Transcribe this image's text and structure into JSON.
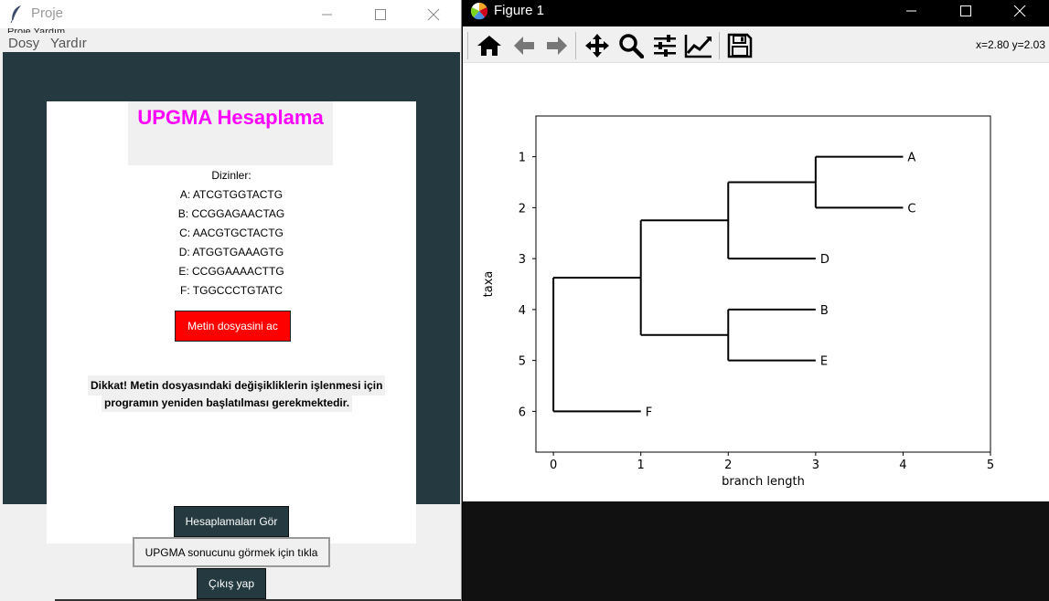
{
  "tk_window": {
    "title": "Proje",
    "clipped_text": "Proje Yardım",
    "menu": [
      "Dosy",
      "Yardır"
    ],
    "heading": "UPGMA Hesaplama",
    "sequences_title": "Dizinler:",
    "sequences": [
      "A: ATCGTGGTACTG",
      "B: CCGGAGAACTAG",
      "C: AACGTGCTACTG",
      "D: ATGGTGAAAGTG",
      "E: CCGGAAAACTTG",
      "F: TGGCCCTGTATC"
    ],
    "open_file_button": "Metin dosyasini ac",
    "warning_line1": "Dikkat! Metin dosyasındaki değişikliklerin işlenmesi için",
    "warning_line2": "programın yeniden başlatılması gerekmektedir.",
    "calc_button": "Hesaplamaları Gör",
    "upgma_button": "UPGMA sonucunu görmek için tıkla",
    "exit_button": "Çıkış yap",
    "colors": {
      "heading": "#ff00ff",
      "dark_bg": "#253a40",
      "open_button": "#ff0000"
    }
  },
  "figure_window": {
    "title": "Figure 1",
    "toolbar": [
      "home-icon",
      "back-icon",
      "forward-icon",
      "pan-icon",
      "zoom-icon",
      "configure-subplots-icon",
      "edit-axis-icon",
      "save-icon"
    ],
    "coord_readout": "x=2.80 y=2.03"
  },
  "chart_data": {
    "type": "dendrogram",
    "xlabel": "branch length",
    "ylabel": "taxa",
    "xlim": [
      -0.2,
      5
    ],
    "ylim": [
      6.8,
      0.2
    ],
    "x_ticks": [
      "0",
      "1",
      "2",
      "3",
      "4",
      "5"
    ],
    "y_ticks": [
      "1",
      "2",
      "3",
      "4",
      "5",
      "6"
    ],
    "leaves": [
      {
        "name": "A",
        "x": 4,
        "y": 1
      },
      {
        "name": "C",
        "x": 4,
        "y": 2
      },
      {
        "name": "D",
        "x": 3,
        "y": 3
      },
      {
        "name": "B",
        "x": 3,
        "y": 4
      },
      {
        "name": "E",
        "x": 3,
        "y": 5
      },
      {
        "name": "F",
        "x": 1,
        "y": 6
      }
    ],
    "internal_nodes": [
      {
        "x": 3,
        "y": 1.5,
        "children": [
          [
            4,
            1
          ],
          [
            4,
            2
          ]
        ]
      },
      {
        "x": 2,
        "y": 2.25,
        "children": [
          [
            3,
            1.5
          ],
          [
            3,
            3
          ]
        ]
      },
      {
        "x": 2,
        "y": 4.5,
        "children": [
          [
            3,
            4
          ],
          [
            3,
            5
          ]
        ]
      },
      {
        "x": 1,
        "y": 3.375,
        "children": [
          [
            2,
            2.25
          ],
          [
            2,
            4.5
          ]
        ]
      },
      {
        "x": 0,
        "y": 4.6875,
        "children": [
          [
            1,
            3.375
          ],
          [
            1,
            6
          ]
        ]
      }
    ]
  }
}
